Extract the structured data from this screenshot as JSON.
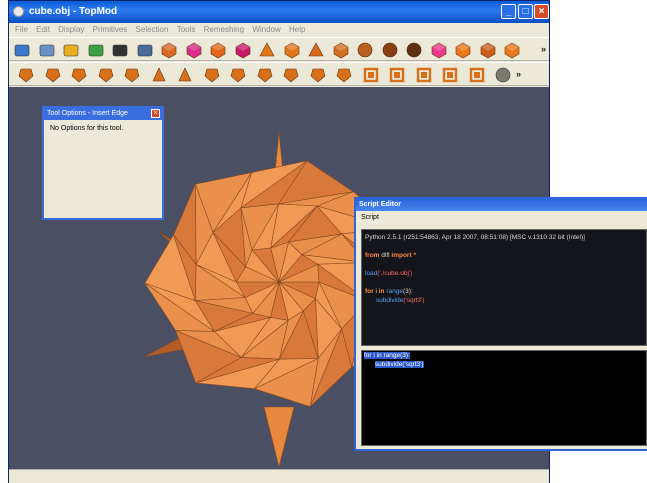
{
  "window": {
    "title": "cube.obj - TopMod",
    "buttons": {
      "minimize": "_",
      "maximize": "□",
      "close": "×"
    }
  },
  "menu": [
    "File",
    "Edit",
    "Display",
    "Primitives",
    "Selection",
    "Tools",
    "Remeshing",
    "Window",
    "Help"
  ],
  "toolbars": {
    "more": "»",
    "row1_icons": [
      "open-folder-icon",
      "save-icon",
      "undo-icon",
      "redo-icon",
      "camera-icon",
      "screen-icon",
      "mesh-cube-1-icon",
      "mesh-cube-2-icon",
      "mesh-cube-3-icon",
      "mesh-cube-4-icon",
      "tetra-icon",
      "octa-icon",
      "pyramid-icon",
      "dodeca-icon",
      "icosa-icon",
      "ball-icon",
      "sphere-icon",
      "cube-red-icon",
      "cube-orange-icon",
      "cube-shade-icon",
      "cube-mix-icon"
    ],
    "row2_icons": [
      "extrude-1-icon",
      "extrude-2-icon",
      "extrude-3-icon",
      "extrude-4-icon",
      "extrude-5-icon",
      "pyramid-small-icon",
      "stellate-icon",
      "doosabin-icon",
      "bevel-icon",
      "chamfer-icon",
      "tile-icon",
      "column-icon",
      "handle-icon",
      "loft-icon",
      "lattice-icon",
      "cage-icon",
      "frame-icon",
      "grid-cube-icon",
      "sculpt-ball-icon"
    ]
  },
  "colors": {
    "mesh": "#e8883f",
    "mesh_dark": "#b45c25",
    "viewport": "#4b4f64"
  },
  "tool_options": {
    "title": "Tool Options - Insert Edge",
    "close": "×",
    "message": "No Options for this tool."
  },
  "script_editor": {
    "title": "Script Editor",
    "menu": "Script",
    "console": {
      "banner": "Python 2.5.1 (r251:54863, Apr 18 2007, 08:51:08) [MSC v.1310 32 bit (Intel)]",
      "line1_kw1": "from",
      "line1_mod": "dlfl",
      "line1_kw2": "import",
      "line1_star": "*",
      "line2_fn": "load",
      "line2_arg": "('./cube.obj')",
      "line3_for": "for",
      "line3_var": "i",
      "line3_in": "in",
      "line3_range": "range",
      "line3_arg": "(3):",
      "line4_fn": "subdivide",
      "line4_arg": "('sqrt3')"
    },
    "editor": {
      "line1": "for i in range(3):",
      "line2": "subdivide('sqrt3')"
    }
  }
}
